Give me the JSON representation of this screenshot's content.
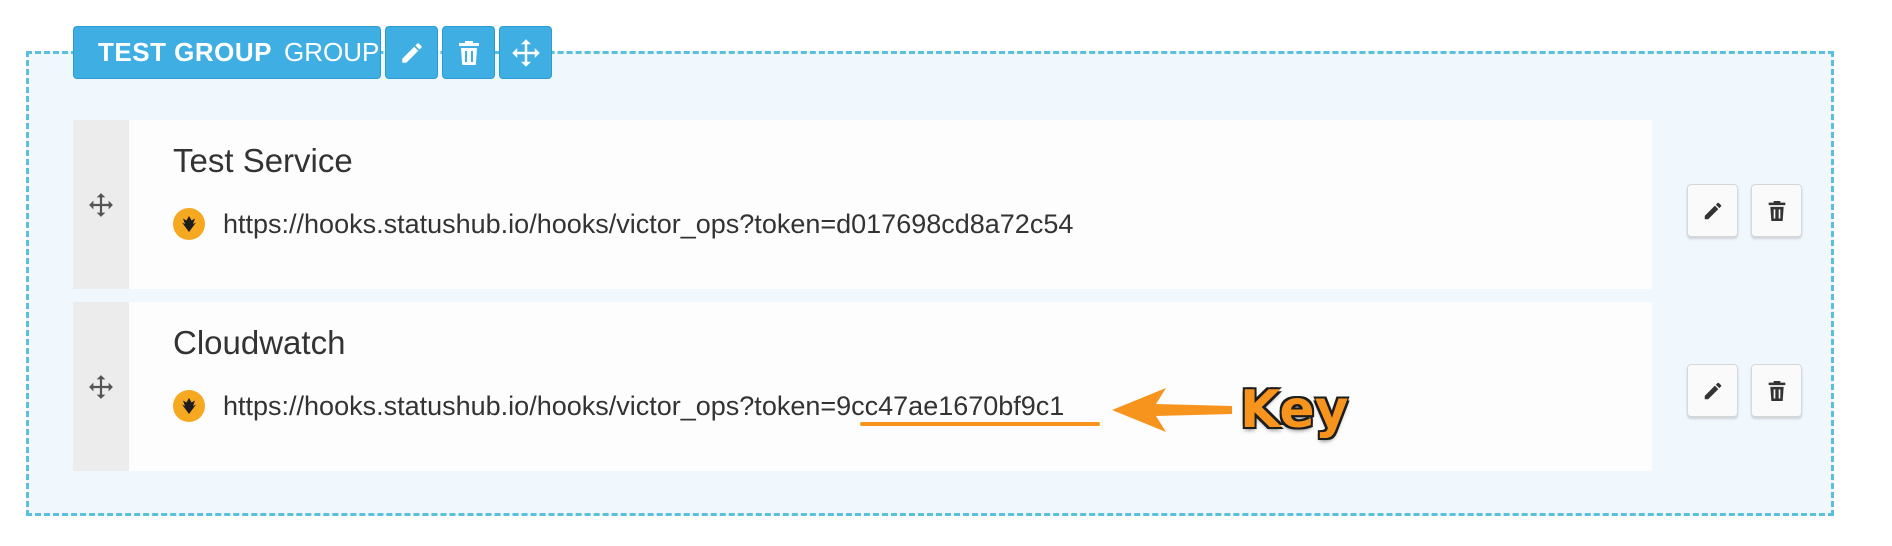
{
  "group": {
    "name": "TEST GROUP",
    "suffix": "GROUP",
    "buttons": [
      {
        "icon": "pencil-icon"
      },
      {
        "icon": "trash-icon"
      },
      {
        "icon": "move-icon"
      }
    ]
  },
  "services": [
    {
      "name": "Test Service",
      "url": "https://hooks.statushub.io/hooks/victor_ops?token=d017698cd8a72c54",
      "icon": "victorops-logo-icon"
    },
    {
      "name": "Cloudwatch",
      "url": "https://hooks.statushub.io/hooks/victor_ops?token=9cc47ae1670bf9c1",
      "icon": "victorops-logo-icon"
    }
  ],
  "annotation": {
    "label": "Key",
    "color": "#f7941d"
  },
  "colors": {
    "accent": "#3eaee3",
    "dashed_border": "#5bc0de",
    "group_background": "#f0f7fd",
    "logo": "#f6a821"
  }
}
